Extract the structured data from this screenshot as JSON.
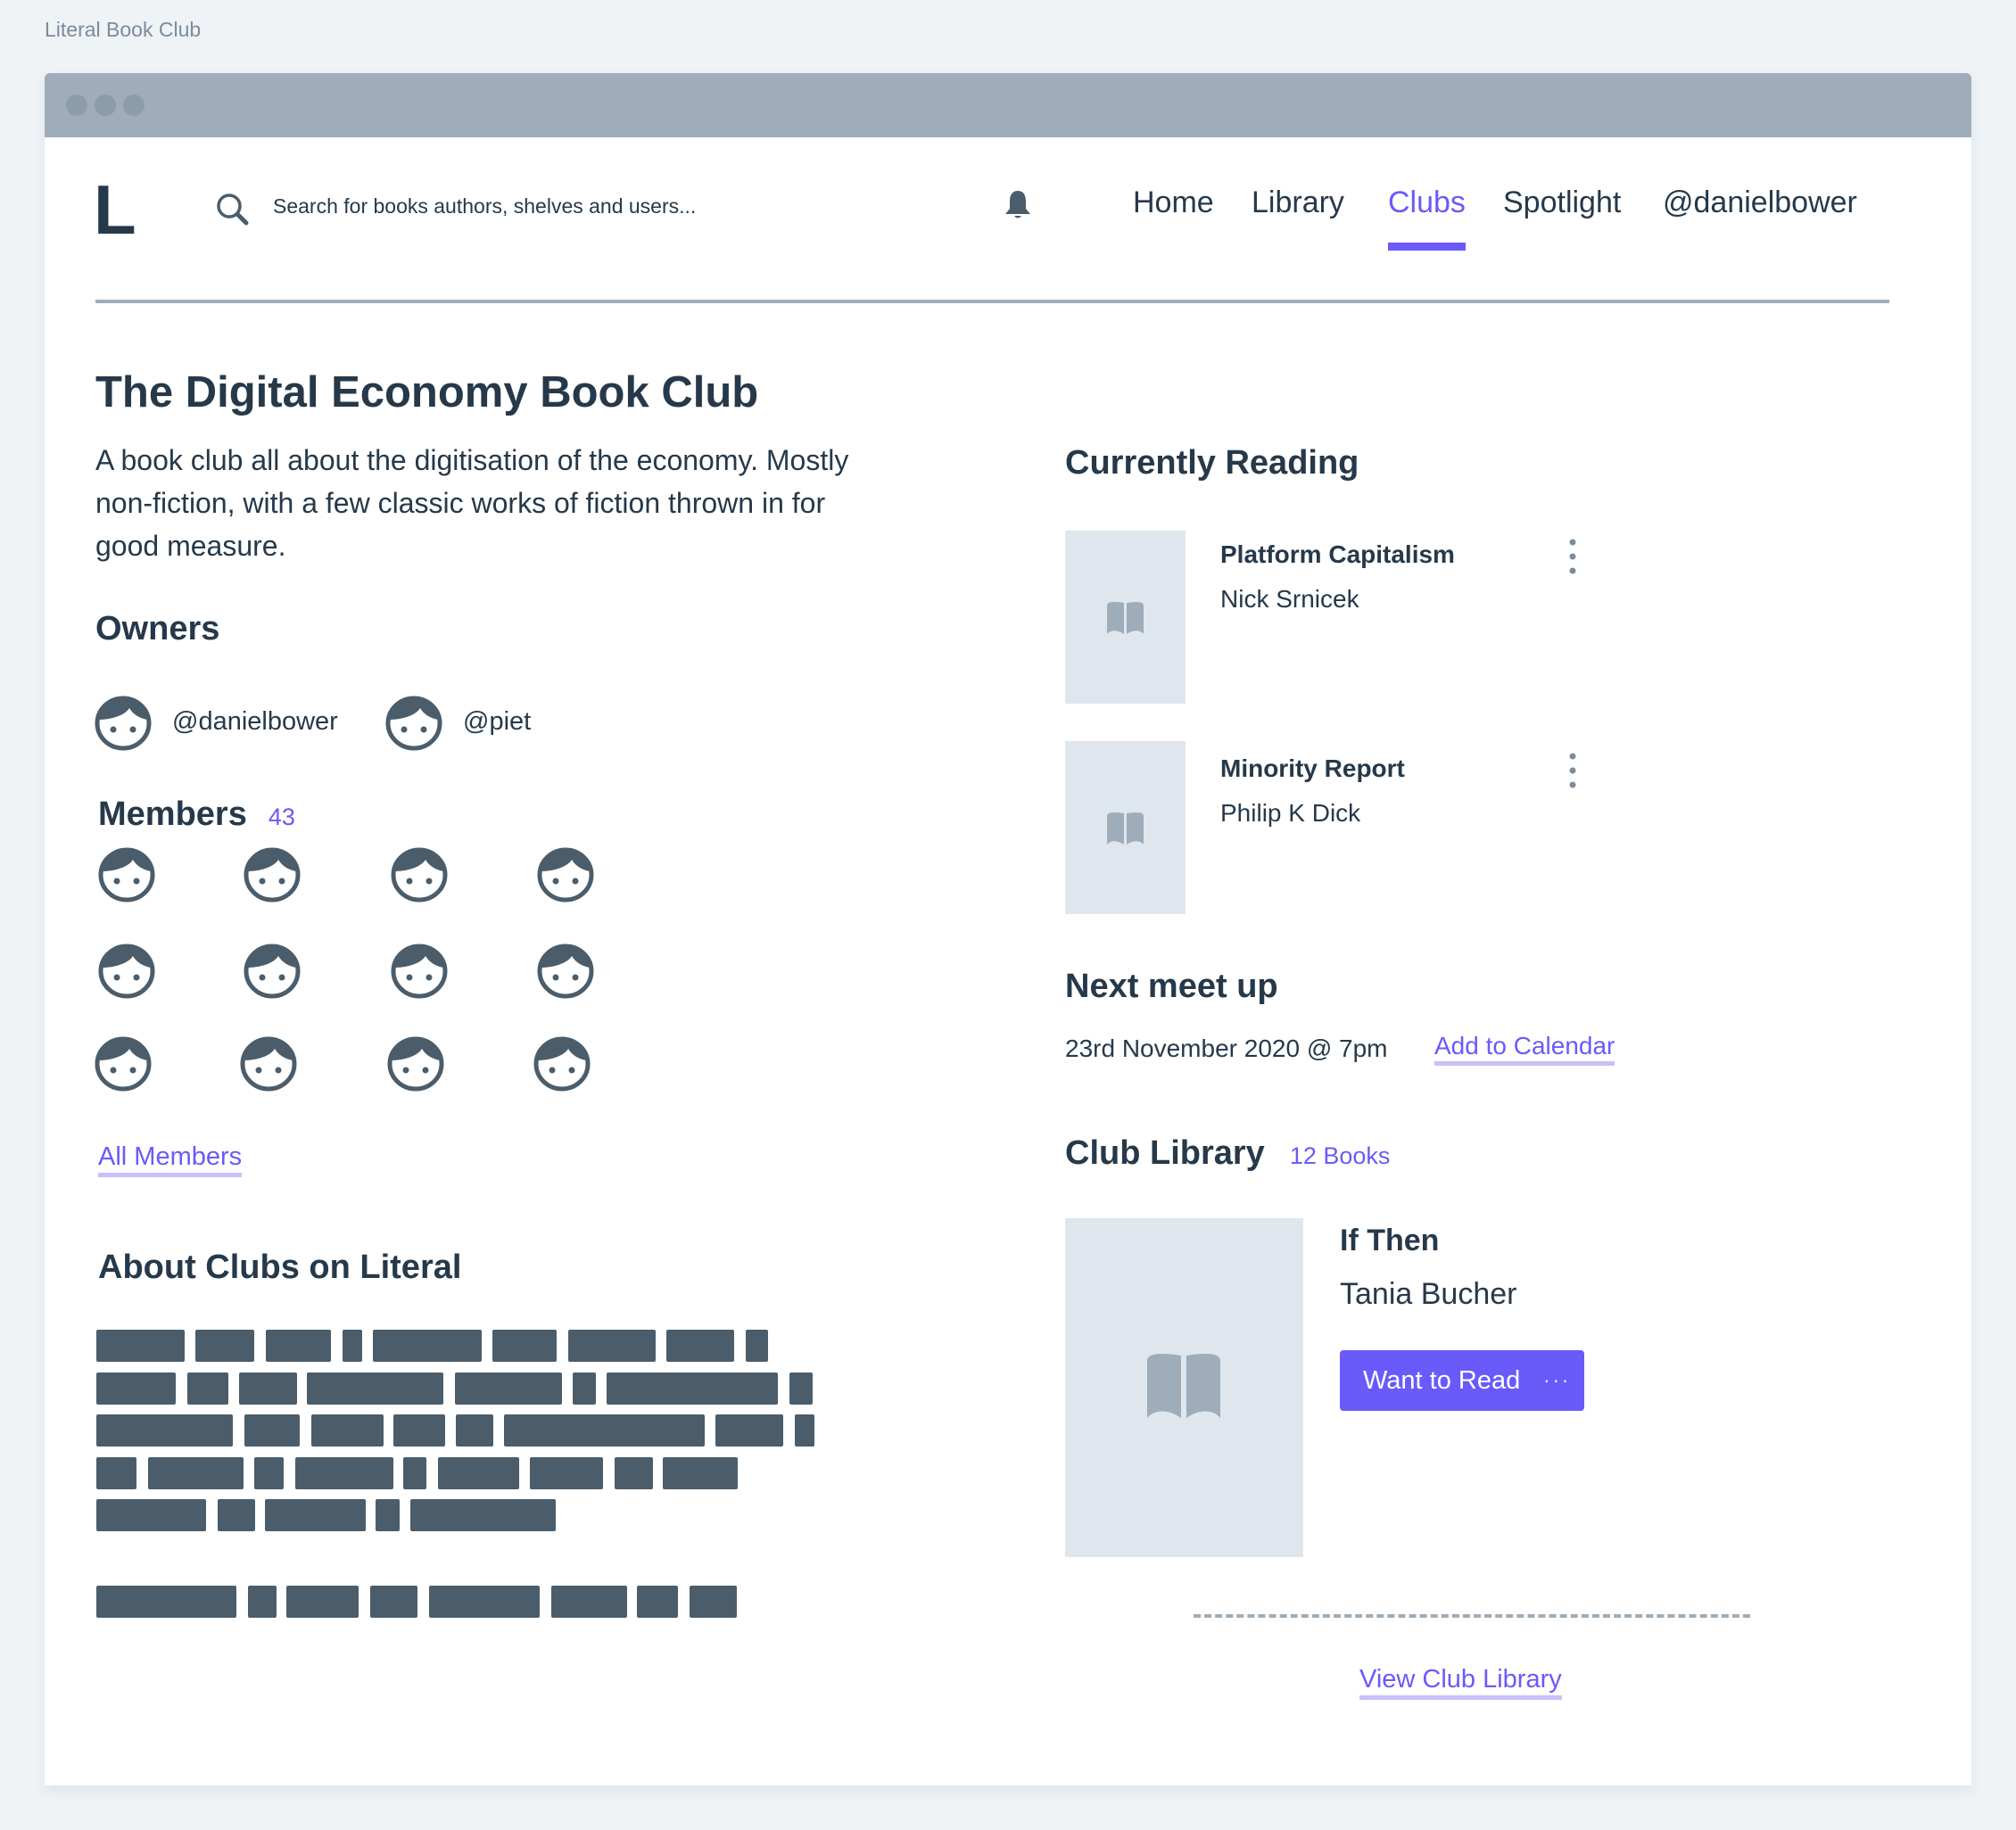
{
  "app_caption": "Literal Book Club",
  "header": {
    "logo": "L",
    "search_placeholder": "Search for books authors, shelves and users...",
    "nav": [
      {
        "label": "Home",
        "active": false
      },
      {
        "label": "Library",
        "active": false
      },
      {
        "label": "Clubs",
        "active": true
      },
      {
        "label": "Spotlight",
        "active": false
      },
      {
        "label": "@danielbower",
        "active": false
      }
    ],
    "icons": {
      "search": "search-icon",
      "notifications": "bell-icon"
    }
  },
  "club": {
    "title": "The Digital Economy Book Club",
    "description": "A book club all about the digitisation of the economy. Mostly non-fiction, with a few classic works of fiction thrown in for good measure.",
    "owners_heading": "Owners",
    "owners": [
      {
        "handle": "@danielbower"
      },
      {
        "handle": "@piet"
      }
    ],
    "members_heading": "Members",
    "members_count": "43",
    "members_shown": 12,
    "all_members_link": "All Members",
    "about_heading": "About Clubs on Literal"
  },
  "currently_reading": {
    "heading": "Currently Reading",
    "books": [
      {
        "title": "Platform Capitalism",
        "author": "Nick Srnicek"
      },
      {
        "title": "Minority Report",
        "author": "Philip K Dick"
      }
    ]
  },
  "next_meetup": {
    "heading": "Next meet up",
    "date": "23rd November 2020 @ 7pm",
    "add_to_calendar": "Add to Calendar"
  },
  "club_library": {
    "heading": "Club Library",
    "count": "12 Books",
    "featured": {
      "title": "If Then",
      "author": "Tania Bucher",
      "button_label": "Want to Read",
      "button_more": "···"
    },
    "view_link": "View Club Library"
  },
  "colors": {
    "accent": "#6a5af9",
    "accent_light": "#c6c0fb",
    "text": "#26394a",
    "muted": "#9eadb9",
    "cover_bg": "#dfe6ee",
    "redacted": "#4b5d6b"
  }
}
